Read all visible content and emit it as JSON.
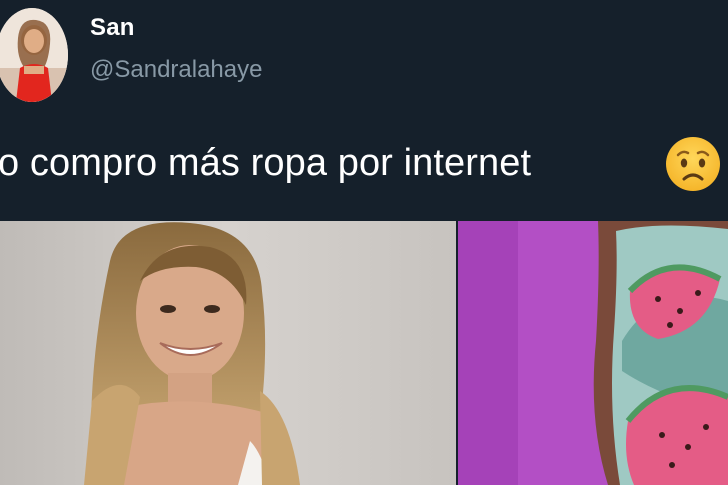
{
  "tweet": {
    "display_name": "San",
    "handle": "@Sandralahaye",
    "text": "o compro más ropa por internet",
    "emoji": "worried-face-icon"
  },
  "colors": {
    "background": "#15202b",
    "name": "#ffffff",
    "handle": "#8899a6",
    "text": "#ffffff"
  },
  "media": {
    "photos": [
      {
        "name": "woman-smiling-photo"
      },
      {
        "name": "watermark-swimsuit-photo"
      }
    ]
  }
}
